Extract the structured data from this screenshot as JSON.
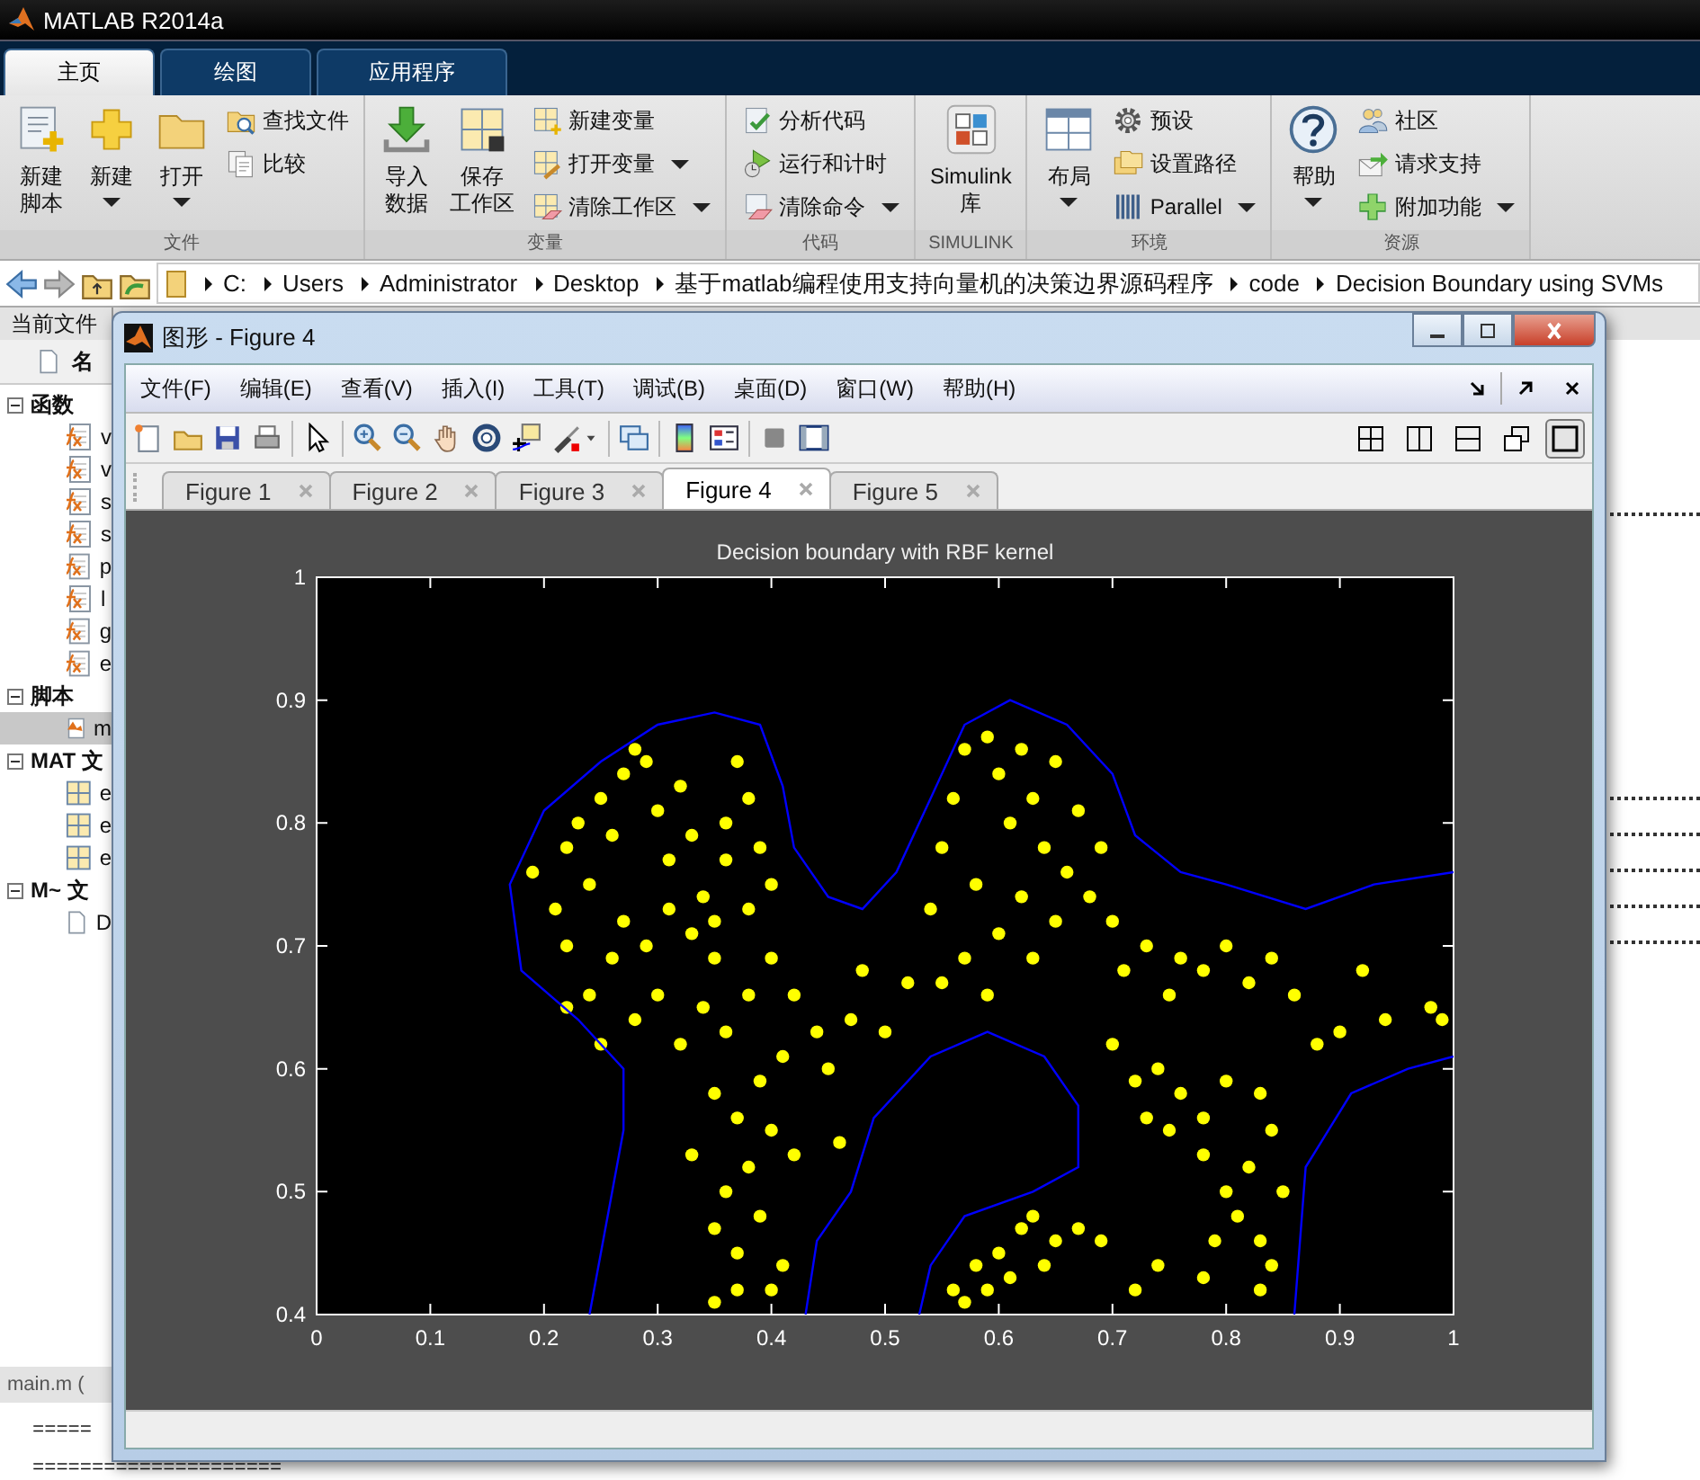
{
  "app_window": {
    "title": "MATLAB R2014a"
  },
  "main_tabs": [
    {
      "label": "主页",
      "selected": true
    },
    {
      "label": "绘图",
      "selected": false
    },
    {
      "label": "应用程序",
      "selected": false
    }
  ],
  "ribbon": {
    "groups": [
      {
        "label": "文件",
        "items": [
          {
            "kind": "big",
            "lines": [
              "新建",
              "脚本"
            ],
            "dropdown": false
          },
          {
            "kind": "big",
            "lines": [
              "新建"
            ],
            "dropdown": true
          },
          {
            "kind": "big",
            "lines": [
              "打开"
            ],
            "dropdown": true
          },
          {
            "kind": "small",
            "lines": [
              "查找文件"
            ],
            "dropdown": false
          },
          {
            "kind": "small",
            "lines": [
              "比较"
            ],
            "dropdown": false
          }
        ]
      },
      {
        "label": "变量",
        "items": [
          {
            "kind": "big",
            "lines": [
              "导入",
              "数据"
            ],
            "dropdown": false
          },
          {
            "kind": "big",
            "lines": [
              "保存",
              "工作区"
            ],
            "dropdown": false
          },
          {
            "kind": "small",
            "lines": [
              "新建变量"
            ],
            "dropdown": false
          },
          {
            "kind": "small",
            "lines": [
              "打开变量"
            ],
            "dropdown": true
          },
          {
            "kind": "small",
            "lines": [
              "清除工作区"
            ],
            "dropdown": true
          }
        ]
      },
      {
        "label": "代码",
        "items": [
          {
            "kind": "small",
            "lines": [
              "分析代码"
            ],
            "dropdown": false
          },
          {
            "kind": "small",
            "lines": [
              "运行和计时"
            ],
            "dropdown": false
          },
          {
            "kind": "small",
            "lines": [
              "清除命令"
            ],
            "dropdown": true
          }
        ]
      },
      {
        "label": "SIMULINK",
        "items": [
          {
            "kind": "big",
            "lines": [
              "Simulink",
              "库"
            ],
            "dropdown": false
          }
        ]
      },
      {
        "label": "环境",
        "items": [
          {
            "kind": "big",
            "lines": [
              "布局"
            ],
            "dropdown": true
          },
          {
            "kind": "small",
            "lines": [
              "预设"
            ],
            "dropdown": false
          },
          {
            "kind": "small",
            "lines": [
              "设置路径"
            ],
            "dropdown": false
          },
          {
            "kind": "small",
            "lines": [
              "Parallel"
            ],
            "dropdown": true
          }
        ]
      },
      {
        "label": "资源",
        "items": [
          {
            "kind": "big",
            "lines": [
              "帮助"
            ],
            "dropdown": true
          },
          {
            "kind": "small",
            "lines": [
              "社区"
            ],
            "dropdown": false
          },
          {
            "kind": "small",
            "lines": [
              "请求支持"
            ],
            "dropdown": false
          },
          {
            "kind": "small",
            "lines": [
              "附加功能"
            ],
            "dropdown": true
          }
        ]
      }
    ]
  },
  "address_bar": {
    "path": [
      "C:",
      "Users",
      "Administrator",
      "Desktop",
      "基于matlab编程使用支持向量机的决策边界源码程序",
      "code",
      "Decision Boundary using SVMs"
    ]
  },
  "current_folder": {
    "title": "当前文件",
    "column_header": "名",
    "tree": [
      {
        "label": "函数",
        "expanded": true,
        "children": [
          {
            "label": "v",
            "kind": "function",
            "selected": false
          },
          {
            "label": "v",
            "kind": "function",
            "selected": false
          },
          {
            "label": "s",
            "kind": "function",
            "selected": false
          },
          {
            "label": "s",
            "kind": "function",
            "selected": false
          },
          {
            "label": "p",
            "kind": "function",
            "selected": false
          },
          {
            "label": "l",
            "kind": "function",
            "selected": false
          },
          {
            "label": "g",
            "kind": "function",
            "selected": false
          },
          {
            "label": "e",
            "kind": "function",
            "selected": false
          }
        ]
      },
      {
        "label": "脚本",
        "expanded": true,
        "children": [
          {
            "label": "m",
            "kind": "script",
            "selected": true
          }
        ]
      },
      {
        "label": "MAT 文",
        "expanded": true,
        "children": [
          {
            "label": "e",
            "kind": "mat",
            "selected": false
          },
          {
            "label": "e",
            "kind": "mat",
            "selected": false
          },
          {
            "label": "e",
            "kind": "mat",
            "selected": false
          }
        ]
      },
      {
        "label": "M~ 文",
        "expanded": true,
        "children": [
          {
            "label": "D",
            "kind": "text",
            "selected": false
          }
        ]
      }
    ]
  },
  "details": {
    "title": "main.m (",
    "lines": [
      "=====",
      "====================="
    ]
  },
  "figure_window": {
    "title": "图形 - Figure 4",
    "menus": [
      "文件(F)",
      "编辑(E)",
      "查看(V)",
      "插入(I)",
      "工具(T)",
      "调试(B)",
      "桌面(D)",
      "窗口(W)",
      "帮助(H)"
    ],
    "layout_buttons": [
      {
        "selected": false
      },
      {
        "selected": false
      },
      {
        "selected": false
      },
      {
        "selected": false
      },
      {
        "selected": true
      }
    ],
    "tabs": [
      {
        "label": "Figure 1",
        "selected": false
      },
      {
        "label": "Figure 2",
        "selected": false
      },
      {
        "label": "Figure 3",
        "selected": false
      },
      {
        "label": "Figure 4",
        "selected": true
      },
      {
        "label": "Figure 5",
        "selected": false
      }
    ],
    "chart_data": {
      "type": "scatter",
      "title": "Decision boundary with RBF kernel",
      "xlim": [
        0,
        1
      ],
      "ylim": [
        0.4,
        1
      ],
      "xticks": [
        {
          "value": 0,
          "label": "0"
        },
        {
          "value": 0.1,
          "label": "0.1"
        },
        {
          "value": 0.2,
          "label": "0.2"
        },
        {
          "value": 0.3,
          "label": "0.3"
        },
        {
          "value": 0.4,
          "label": "0.4"
        },
        {
          "value": 0.5,
          "label": "0.5"
        },
        {
          "value": 0.6,
          "label": "0.6"
        },
        {
          "value": 0.7,
          "label": "0.7"
        },
        {
          "value": 0.8,
          "label": "0.8"
        },
        {
          "value": 0.9,
          "label": "0.9"
        },
        {
          "value": 1,
          "label": "1"
        }
      ],
      "yticks": [
        {
          "value": 0.4,
          "label": "0.4"
        },
        {
          "value": 0.5,
          "label": "0.5"
        },
        {
          "value": 0.6,
          "label": "0.6"
        },
        {
          "value": 0.7,
          "label": "0.7"
        },
        {
          "value": 0.8,
          "label": "0.8"
        },
        {
          "value": 0.9,
          "label": "0.9"
        },
        {
          "value": 1,
          "label": "1"
        }
      ],
      "series": [
        {
          "color": "#ffff00",
          "x": [
            0.19,
            0.21,
            0.22,
            0.23,
            0.22,
            0.24,
            0.25,
            0.26,
            0.27,
            0.28,
            0.29,
            0.3,
            0.31,
            0.32,
            0.33,
            0.34,
            0.35,
            0.36,
            0.37,
            0.38,
            0.36,
            0.35,
            0.38,
            0.39,
            0.4,
            0.33,
            0.31,
            0.29,
            0.27,
            0.26,
            0.24,
            0.22,
            0.25,
            0.28,
            0.3,
            0.32,
            0.34,
            0.36,
            0.38,
            0.4,
            0.42,
            0.44,
            0.41,
            0.39,
            0.37,
            0.35,
            0.33,
            0.36,
            0.38,
            0.4,
            0.42,
            0.35,
            0.37,
            0.39,
            0.41,
            0.37,
            0.35,
            0.4,
            0.45,
            0.47,
            0.48,
            0.5,
            0.46,
            0.52,
            0.54,
            0.55,
            0.56,
            0.57,
            0.59,
            0.6,
            0.61,
            0.62,
            0.63,
            0.64,
            0.65,
            0.66,
            0.67,
            0.68,
            0.69,
            0.7,
            0.58,
            0.6,
            0.62,
            0.57,
            0.55,
            0.59,
            0.63,
            0.65,
            0.71,
            0.73,
            0.75,
            0.76,
            0.78,
            0.8,
            0.82,
            0.84,
            0.86,
            0.88,
            0.9,
            0.92,
            0.94,
            0.98,
            0.99,
            0.7,
            0.72,
            0.74,
            0.76,
            0.78,
            0.8,
            0.73,
            0.75,
            0.78,
            0.8,
            0.82,
            0.83,
            0.84,
            0.85,
            0.81,
            0.79,
            0.83,
            0.78,
            0.74,
            0.72,
            0.84,
            0.83,
            0.56,
            0.57,
            0.58,
            0.6,
            0.62,
            0.63,
            0.65,
            0.67,
            0.69,
            0.61,
            0.64,
            0.59
          ],
          "values": [
            0.76,
            0.73,
            0.78,
            0.8,
            0.7,
            0.75,
            0.82,
            0.79,
            0.84,
            0.86,
            0.85,
            0.81,
            0.77,
            0.83,
            0.79,
            0.74,
            0.72,
            0.8,
            0.85,
            0.82,
            0.77,
            0.69,
            0.73,
            0.78,
            0.75,
            0.71,
            0.73,
            0.7,
            0.72,
            0.69,
            0.66,
            0.65,
            0.62,
            0.64,
            0.66,
            0.62,
            0.65,
            0.63,
            0.66,
            0.69,
            0.66,
            0.63,
            0.61,
            0.59,
            0.56,
            0.58,
            0.53,
            0.5,
            0.52,
            0.55,
            0.53,
            0.47,
            0.45,
            0.48,
            0.44,
            0.42,
            0.41,
            0.42,
            0.6,
            0.64,
            0.68,
            0.63,
            0.54,
            0.67,
            0.73,
            0.78,
            0.82,
            0.86,
            0.87,
            0.84,
            0.8,
            0.86,
            0.82,
            0.78,
            0.85,
            0.76,
            0.81,
            0.74,
            0.78,
            0.72,
            0.75,
            0.71,
            0.74,
            0.69,
            0.67,
            0.66,
            0.69,
            0.72,
            0.68,
            0.7,
            0.66,
            0.69,
            0.68,
            0.7,
            0.67,
            0.69,
            0.66,
            0.62,
            0.63,
            0.68,
            0.64,
            0.65,
            0.64,
            0.62,
            0.59,
            0.6,
            0.58,
            0.56,
            0.59,
            0.56,
            0.55,
            0.53,
            0.5,
            0.52,
            0.58,
            0.55,
            0.5,
            0.48,
            0.46,
            0.46,
            0.43,
            0.44,
            0.42,
            0.44,
            0.42,
            0.42,
            0.41,
            0.44,
            0.45,
            0.47,
            0.48,
            0.46,
            0.47,
            0.46,
            0.43,
            0.44,
            0.42
          ]
        },
        {
          "type": "line",
          "color": "#0000ff",
          "x": [
            0.24,
            0.27,
            0.27,
            0.23,
            0.18,
            0.17,
            0.2,
            0.25,
            0.3,
            0.35,
            0.39,
            0.41,
            0.42,
            0.45,
            0.48,
            0.51,
            0.54,
            0.57,
            0.61,
            0.66,
            0.7,
            0.72,
            0.76,
            0.8,
            0.87,
            0.93,
            1
          ],
          "values": [
            0.4,
            0.55,
            0.6,
            0.64,
            0.68,
            0.75,
            0.81,
            0.85,
            0.88,
            0.89,
            0.88,
            0.83,
            0.78,
            0.74,
            0.73,
            0.76,
            0.82,
            0.88,
            0.9,
            0.88,
            0.84,
            0.79,
            0.76,
            0.75,
            0.73,
            0.75,
            0.76
          ]
        },
        {
          "type": "line",
          "color": "#0000ff",
          "x": [
            0.43,
            0.44,
            0.47,
            0.49,
            0.54,
            0.59,
            0.64,
            0.67,
            0.67,
            0.63,
            0.57,
            0.54,
            0.53
          ],
          "values": [
            0.4,
            0.46,
            0.5,
            0.56,
            0.61,
            0.63,
            0.61,
            0.57,
            0.52,
            0.5,
            0.48,
            0.44,
            0.4
          ]
        },
        {
          "type": "line",
          "color": "#0000ff",
          "x": [
            0.86,
            0.87,
            0.91,
            0.96,
            1
          ],
          "values": [
            0.4,
            0.52,
            0.58,
            0.6,
            0.61
          ]
        }
      ]
    }
  }
}
